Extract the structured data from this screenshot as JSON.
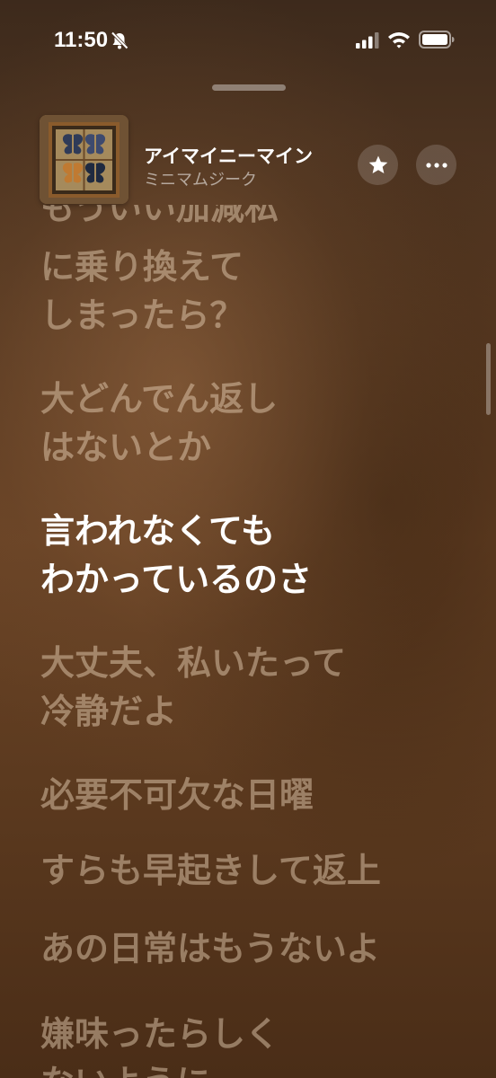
{
  "status_bar": {
    "time": "11:50",
    "icons": [
      "bell-slash-icon",
      "cellular-signal-icon",
      "wifi-icon",
      "battery-icon"
    ]
  },
  "now_playing": {
    "title": "アイマイニーマイン",
    "artist": "ミニマムジーク",
    "artwork": "album-artwork-butterflies",
    "favorite_icon": "star-icon",
    "more_icon": "ellipsis-icon"
  },
  "lyrics": {
    "current_index": 2,
    "lines": [
      {
        "line1": "もういい加減私",
        "line2": ""
      },
      {
        "line1": "に乗り換えて",
        "line2": "しまったら？"
      },
      {
        "line1": "大どんでん返し",
        "line2": "はないとか"
      },
      {
        "line1": "言われなくても",
        "line2": "わかっているのさ"
      },
      {
        "line1": "大丈夫、私いたって",
        "line2": "冷静だよ"
      },
      {
        "line1": "必要不可欠な日曜",
        "line2": ""
      },
      {
        "line1": "すらも早起きして返上",
        "line2": ""
      },
      {
        "line1": "あの日常はもうないよ",
        "line2": ""
      },
      {
        "line1": "嫌味ったらしく",
        "line2": "ないように"
      }
    ]
  },
  "colors": {
    "current_lyric": "#ffffff",
    "inactive_lyric": "#e8d0b6",
    "background": "#5a3b23"
  }
}
